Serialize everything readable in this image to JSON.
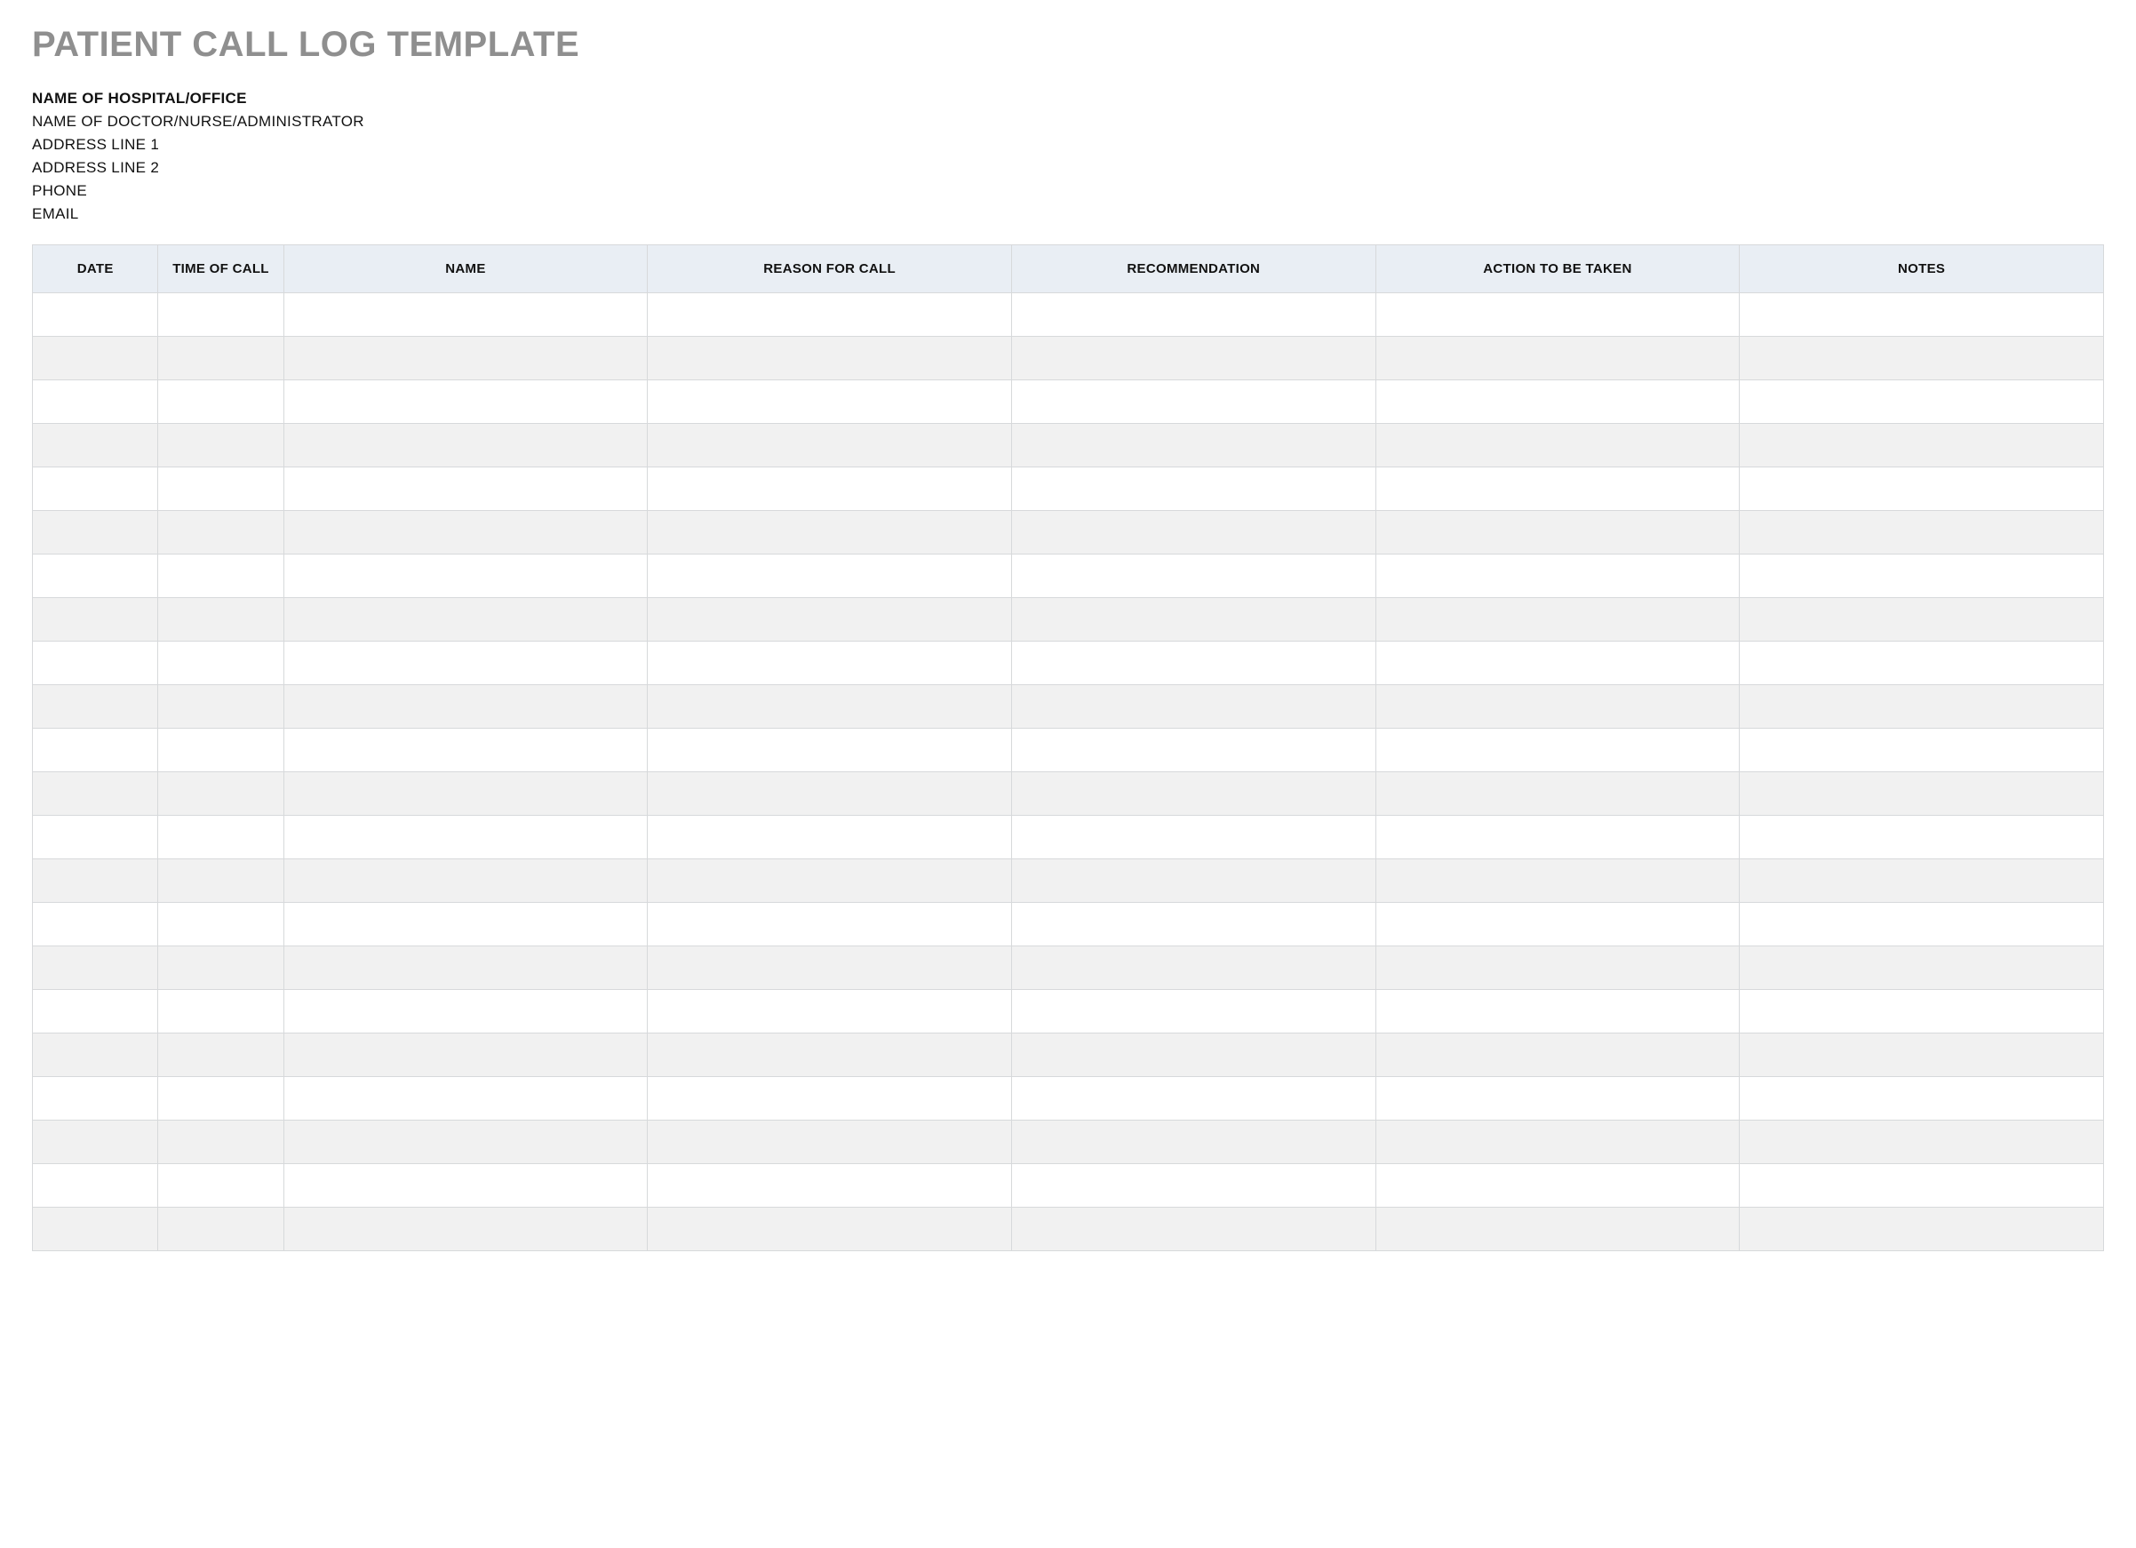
{
  "title": "PATIENT CALL LOG TEMPLATE",
  "info": {
    "hospital": "NAME OF HOSPITAL/OFFICE",
    "staff": "NAME OF DOCTOR/NURSE/ADMINISTRATOR",
    "address1": "ADDRESS LINE 1",
    "address2": "ADDRESS LINE 2",
    "phone": "PHONE",
    "email": "EMAIL"
  },
  "table": {
    "headers": {
      "date": "DATE",
      "time": "TIME OF CALL",
      "name": "NAME",
      "reason": "REASON FOR CALL",
      "recommendation": "RECOMMENDATION",
      "action": "ACTION TO BE TAKEN",
      "notes": "NOTES"
    },
    "row_count": 22,
    "rows": [
      {
        "date": "",
        "time": "",
        "name": "",
        "reason": "",
        "recommendation": "",
        "action": "",
        "notes": ""
      },
      {
        "date": "",
        "time": "",
        "name": "",
        "reason": "",
        "recommendation": "",
        "action": "",
        "notes": ""
      },
      {
        "date": "",
        "time": "",
        "name": "",
        "reason": "",
        "recommendation": "",
        "action": "",
        "notes": ""
      },
      {
        "date": "",
        "time": "",
        "name": "",
        "reason": "",
        "recommendation": "",
        "action": "",
        "notes": ""
      },
      {
        "date": "",
        "time": "",
        "name": "",
        "reason": "",
        "recommendation": "",
        "action": "",
        "notes": ""
      },
      {
        "date": "",
        "time": "",
        "name": "",
        "reason": "",
        "recommendation": "",
        "action": "",
        "notes": ""
      },
      {
        "date": "",
        "time": "",
        "name": "",
        "reason": "",
        "recommendation": "",
        "action": "",
        "notes": ""
      },
      {
        "date": "",
        "time": "",
        "name": "",
        "reason": "",
        "recommendation": "",
        "action": "",
        "notes": ""
      },
      {
        "date": "",
        "time": "",
        "name": "",
        "reason": "",
        "recommendation": "",
        "action": "",
        "notes": ""
      },
      {
        "date": "",
        "time": "",
        "name": "",
        "reason": "",
        "recommendation": "",
        "action": "",
        "notes": ""
      },
      {
        "date": "",
        "time": "",
        "name": "",
        "reason": "",
        "recommendation": "",
        "action": "",
        "notes": ""
      },
      {
        "date": "",
        "time": "",
        "name": "",
        "reason": "",
        "recommendation": "",
        "action": "",
        "notes": ""
      },
      {
        "date": "",
        "time": "",
        "name": "",
        "reason": "",
        "recommendation": "",
        "action": "",
        "notes": ""
      },
      {
        "date": "",
        "time": "",
        "name": "",
        "reason": "",
        "recommendation": "",
        "action": "",
        "notes": ""
      },
      {
        "date": "",
        "time": "",
        "name": "",
        "reason": "",
        "recommendation": "",
        "action": "",
        "notes": ""
      },
      {
        "date": "",
        "time": "",
        "name": "",
        "reason": "",
        "recommendation": "",
        "action": "",
        "notes": ""
      },
      {
        "date": "",
        "time": "",
        "name": "",
        "reason": "",
        "recommendation": "",
        "action": "",
        "notes": ""
      },
      {
        "date": "",
        "time": "",
        "name": "",
        "reason": "",
        "recommendation": "",
        "action": "",
        "notes": ""
      },
      {
        "date": "",
        "time": "",
        "name": "",
        "reason": "",
        "recommendation": "",
        "action": "",
        "notes": ""
      },
      {
        "date": "",
        "time": "",
        "name": "",
        "reason": "",
        "recommendation": "",
        "action": "",
        "notes": ""
      },
      {
        "date": "",
        "time": "",
        "name": "",
        "reason": "",
        "recommendation": "",
        "action": "",
        "notes": ""
      },
      {
        "date": "",
        "time": "",
        "name": "",
        "reason": "",
        "recommendation": "",
        "action": "",
        "notes": ""
      }
    ]
  }
}
